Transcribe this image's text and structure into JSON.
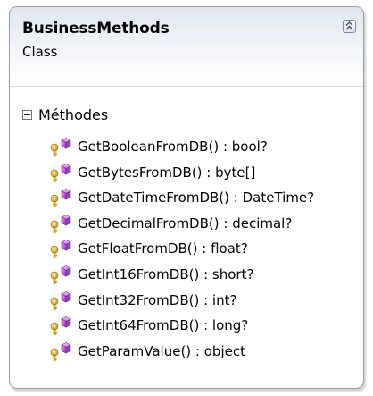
{
  "class": {
    "name": "BusinessMethods",
    "kind": "Class"
  },
  "section": {
    "label": "Méthodes"
  },
  "methods": [
    "GetBooleanFromDB() : bool?",
    "GetBytesFromDB() : byte[]",
    "GetDateTimeFromDB() : DateTime?",
    "GetDecimalFromDB() : decimal?",
    "GetFloatFromDB() : float?",
    "GetInt16FromDB() : short?",
    "GetInt32FromDB() : int?",
    "GetInt64FromDB() : long?",
    "GetParamValue() : object"
  ],
  "icons": {
    "collapse": "collapse-chevrons-icon",
    "section_toggle": "minus-box-icon",
    "method": "public-static-method-icon"
  },
  "colors": {
    "header_top": "#dfe6f0",
    "border": "#9b9b9b",
    "method_icon_purple": "#b44fd1",
    "method_icon_key": "#d9a514"
  }
}
